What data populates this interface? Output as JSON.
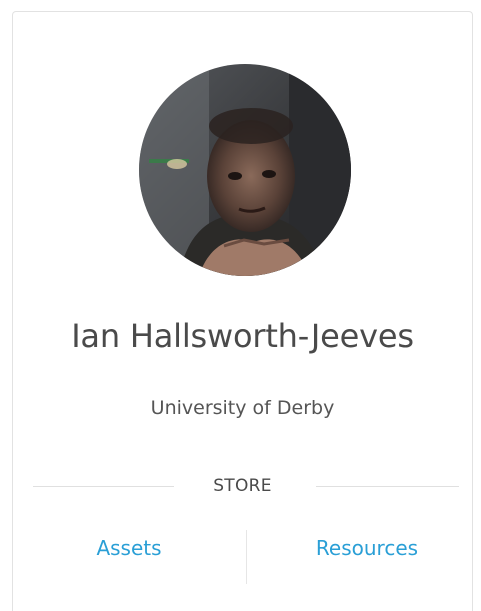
{
  "profile": {
    "name": "Ian Hallsworth-Jeeves",
    "organization": "University of Derby",
    "avatar_icon": "profile-photo"
  },
  "store": {
    "label": "STORE",
    "links": {
      "assets": "Assets",
      "resources": "Resources"
    },
    "link_color": "#2a9fd6"
  }
}
